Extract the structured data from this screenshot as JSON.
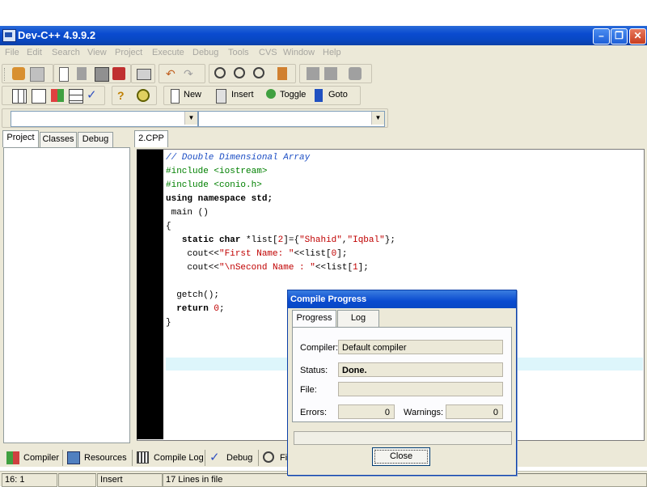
{
  "window": {
    "title": "Dev-C++ 4.9.9.2"
  },
  "menu": [
    "File",
    "Edit",
    "Search",
    "View",
    "Project",
    "Execute",
    "Debug",
    "Tools",
    "CVS",
    "Window",
    "Help"
  ],
  "toolbar": {
    "new_label": "New",
    "insert_label": "Insert",
    "toggle_label": "Toggle",
    "goto_label": "Goto"
  },
  "left_tabs": [
    "Project",
    "Classes",
    "Debug"
  ],
  "editor": {
    "file_tab": "2.CPP",
    "lines": [
      "// Double Dimensional Array",
      "#include <iostream>",
      "#include <conio.h>",
      "using namespace std;",
      " main ()",
      "{",
      "   static char *list[2]={\"Shahid\",\"Iqbal\"};",
      "    cout<<\"First Name: \"<<list[0];",
      "    cout<<\"\\nSecond Name : \"<<list[1];",
      "",
      "  getch();",
      "  return 0;",
      "}"
    ]
  },
  "bottom_tabs": [
    "Compiler",
    "Resources",
    "Compile Log",
    "Debug",
    "Fi"
  ],
  "status": {
    "position": "16: 1",
    "mode": "Insert",
    "lines": "17 Lines in file"
  },
  "dialog": {
    "title": "Compile Progress",
    "tabs": [
      "Progress",
      "Log"
    ],
    "compiler_label": "Compiler:",
    "compiler_value": "Default compiler",
    "status_label": "Status:",
    "status_value": "Done.",
    "file_label": "File:",
    "file_value": "",
    "errors_label": "Errors:",
    "errors_value": "0",
    "warnings_label": "Warnings:",
    "warnings_value": "0",
    "close_label": "Close"
  },
  "icons": {
    "titlebar": [
      "minimize-icon",
      "restore-icon",
      "close-icon"
    ]
  }
}
